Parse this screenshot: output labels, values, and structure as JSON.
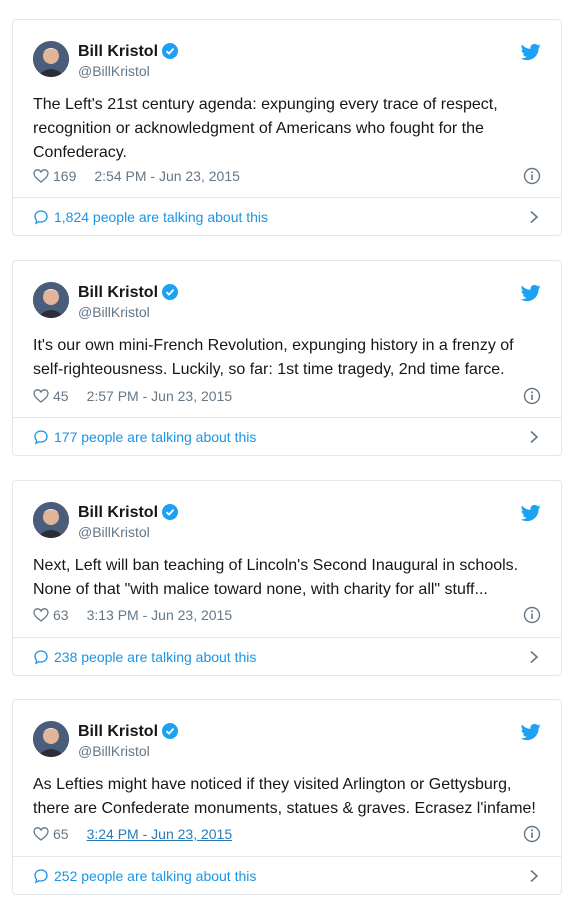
{
  "tweets": [
    {
      "author": "Bill Kristol",
      "handle": "@BillKristol",
      "text": "The Left's 21st century agenda: expunging every trace of respect, recognition or acknowledgment of Americans who fought for the Confederacy.",
      "likes": "169",
      "time": "2:54 PM - Jun 23, 2015",
      "talking": "1,824 people are talking about this"
    },
    {
      "author": "Bill Kristol",
      "handle": "@BillKristol",
      "text": "It's our own mini-French Revolution, expunging history in a frenzy of self-righteousness. Luckily, so far: 1st time tragedy, 2nd time farce.",
      "likes": "45",
      "time": "2:57 PM - Jun 23, 2015",
      "talking": "177 people are talking about this"
    },
    {
      "author": "Bill Kristol",
      "handle": "@BillKristol",
      "text": "Next, Left will ban teaching of Lincoln's Second Inaugural in schools. None of that \"with malice toward none, with charity for all\" stuff...",
      "likes": "63",
      "time": "3:13 PM - Jun 23, 2015",
      "talking": "238 people are talking about this"
    },
    {
      "author": "Bill Kristol",
      "handle": "@BillKristol",
      "text": "As Lefties might have noticed if they visited Arlington or Gettysburg, there are Confederate monuments, statues & graves. Ecrasez l'infame!",
      "likes": "65",
      "time": "3:24 PM - Jun 23, 2015",
      "talking": "252 people are talking about this"
    }
  ],
  "icons": {
    "verified": "verified-badge-icon",
    "brand": "twitter-bird-icon",
    "like": "heart-icon",
    "info": "info-icon",
    "reply": "speech-bubble-icon",
    "expand": "chevron-right-icon"
  },
  "colors": {
    "accent": "#1da1f2",
    "link": "#1b95e0",
    "muted": "#657786",
    "border": "#e1e8ed"
  }
}
